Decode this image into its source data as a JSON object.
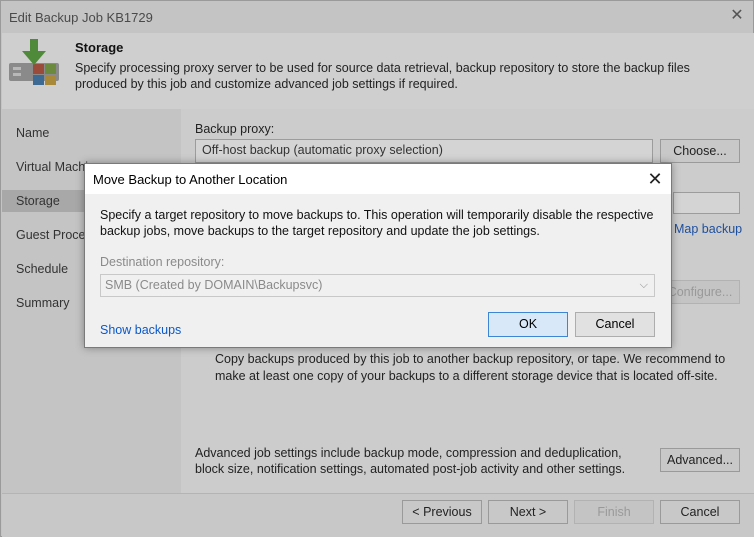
{
  "window": {
    "title": "Edit Backup Job KB1729"
  },
  "header": {
    "title": "Storage",
    "description": "Specify processing proxy server to be used for source data retrieval, backup repository to store the backup files produced by this job and customize advanced job settings if required."
  },
  "sidebar": {
    "items": [
      {
        "label": "Name"
      },
      {
        "label": "Virtual Machi"
      },
      {
        "label": "Storage"
      },
      {
        "label": "Guest Proces"
      },
      {
        "label": "Schedule"
      },
      {
        "label": "Summary"
      }
    ]
  },
  "main": {
    "backup_proxy_label": "Backup proxy:",
    "backup_proxy_value": "Off-host backup (automatic proxy selection)",
    "choose_label": "Choose...",
    "map_backup_label": "Map backup",
    "configure_label": "Configure...",
    "secondary_text": "Copy backups produced by this job to another backup repository, or tape. We recommend to make at least one copy of your backups to a different storage device that is located off-site.",
    "advanced_text": "Advanced job settings include backup mode, compression and deduplication, block size, notification settings, automated post-job activity and other settings.",
    "advanced_label": "Advanced..."
  },
  "footer": {
    "previous_label": "< Previous",
    "next_label": "Next >",
    "finish_label": "Finish",
    "cancel_label": "Cancel"
  },
  "dialog": {
    "title": "Move Backup to Another Location",
    "description": "Specify a target repository to move backups to. This operation will temporarily disable the respective backup jobs, move backups to the target repository and update the job settings.",
    "destination_label": "Destination repository:",
    "destination_value": "SMB (Created by DOMAIN\\Backupsvc)",
    "show_backups_label": "Show backups",
    "ok_label": "OK",
    "cancel_label": "Cancel"
  }
}
